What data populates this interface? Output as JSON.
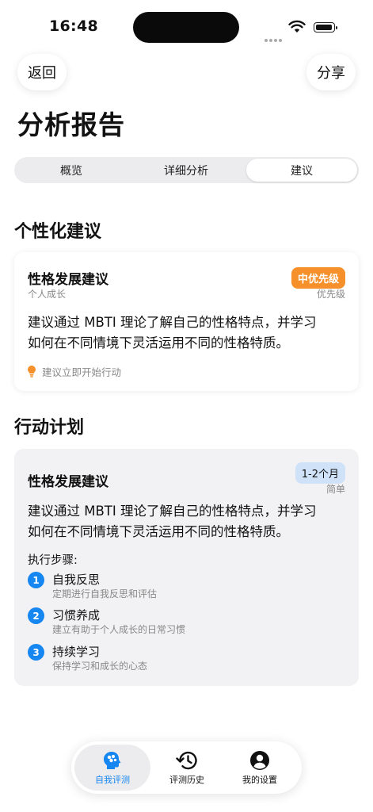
{
  "status_bar": {
    "time": "16:48"
  },
  "nav": {
    "back_label": "返回",
    "share_label": "分享"
  },
  "page_title": "分析报告",
  "segments": [
    {
      "label": "概览",
      "active": false
    },
    {
      "label": "详细分析",
      "active": false
    },
    {
      "label": "建议",
      "active": true
    }
  ],
  "personalized": {
    "section_title": "个性化建议",
    "card": {
      "title": "性格发展建议",
      "category": "个人成长",
      "priority_badge": "中优先级",
      "priority_label": "优先级",
      "body_line1": "建议通过 MBTI 理论了解自己的性格特点，并学习",
      "body_line2": "如何在不同情境下灵活运用不同的性格特质。",
      "hint": "建议立即开始行动"
    }
  },
  "action_plan": {
    "section_title": "行动计划",
    "card": {
      "title": "性格发展建议",
      "duration_badge": "1-2个月",
      "difficulty": "简单",
      "body_line1": "建议通过 MBTI 理论了解自己的性格特点，并学习",
      "body_line2": "如何在不同情境下灵活运用不同的性格特质。",
      "steps_label": "执行步骤:",
      "steps": [
        {
          "num": "1",
          "title": "自我反思",
          "desc": "定期进行自我反思和评估"
        },
        {
          "num": "2",
          "title": "习惯养成",
          "desc": "建立有助于个人成长的日常习惯"
        },
        {
          "num": "3",
          "title": "持续学习",
          "desc": "保持学习和成长的心态"
        }
      ]
    }
  },
  "tabbar": [
    {
      "label": "自我评测",
      "icon": "brain-head-icon",
      "active": true
    },
    {
      "label": "评测历史",
      "icon": "history-clock-icon",
      "active": false
    },
    {
      "label": "我的设置",
      "icon": "person-circle-icon",
      "active": false
    }
  ],
  "colors": {
    "accent": "#1686f0",
    "priority": "#f6902a",
    "duration_badge": "#cfe2f7"
  }
}
